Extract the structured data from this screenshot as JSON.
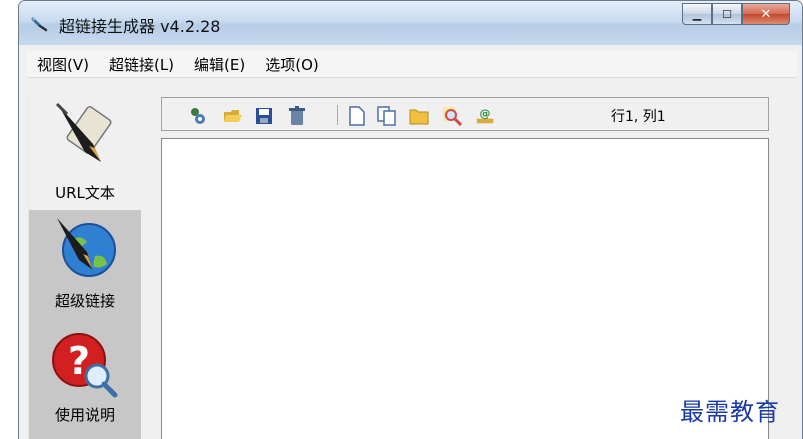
{
  "window": {
    "title": "超链接生成器 v4.2.28"
  },
  "menu": {
    "items": [
      "视图(V)",
      "超链接(L)",
      "编辑(E)",
      "选项(O)"
    ]
  },
  "sidebar": {
    "items": [
      {
        "label": "URL文本",
        "icon": "pen-scroll-icon",
        "active": true
      },
      {
        "label": "超级链接",
        "icon": "globe-pen-icon",
        "active": false
      },
      {
        "label": "使用说明",
        "icon": "help-magnifier-icon",
        "active": false
      }
    ]
  },
  "toolbar": {
    "buttons": [
      "link-icon",
      "open-folder-icon",
      "save-icon",
      "clear-icon",
      "new-doc-icon",
      "copy-icon",
      "folder-icon",
      "find-icon",
      "email-icon"
    ],
    "cursor_position": "行1, 列1"
  },
  "watermark": "最需教育",
  "colors": {
    "title_gradient_top": "#e5eef8",
    "close_button": "#c2482d",
    "sidebar_bg": "#c7c7c7"
  }
}
